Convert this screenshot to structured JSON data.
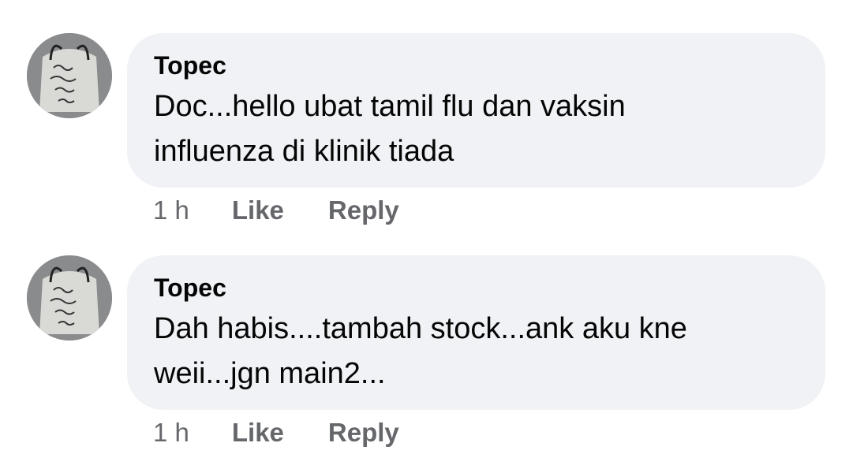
{
  "comments": [
    {
      "author": "Topec",
      "text": "Doc...hello ubat tamil flu dan vaksin\ninfluenza di klinik tiada",
      "time": "1 h",
      "like_label": "Like",
      "reply_label": "Reply"
    },
    {
      "author": "Topec",
      "text": "Dah habis....tambah stock...ank aku kne\nweii...jgn main2...",
      "time": "1 h",
      "like_label": "Like",
      "reply_label": "Reply"
    }
  ],
  "colors": {
    "bubble": "#f0f2f5",
    "text": "#050505",
    "meta": "#65676b"
  }
}
